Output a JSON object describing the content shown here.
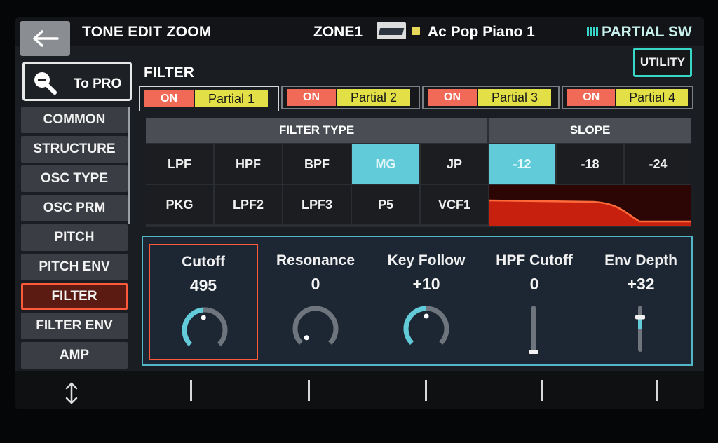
{
  "header": {
    "title": "TONE EDIT ZOOM",
    "zone": "ZONE1",
    "tone_name": "Ac Pop Piano 1",
    "partial_sw": "PARTIAL SW"
  },
  "sidebar": {
    "to_pro": "To PRO",
    "items": [
      {
        "label": "COMMON"
      },
      {
        "label": "STRUCTURE"
      },
      {
        "label": "OSC TYPE"
      },
      {
        "label": "OSC PRM"
      },
      {
        "label": "PITCH"
      },
      {
        "label": "PITCH ENV"
      },
      {
        "label": "FILTER"
      },
      {
        "label": "FILTER ENV"
      },
      {
        "label": "AMP"
      }
    ],
    "active": "FILTER"
  },
  "section_title": "FILTER",
  "utility": "UTILITY",
  "partials": [
    {
      "on": "ON",
      "name": "Partial 1"
    },
    {
      "on": "ON",
      "name": "Partial 2"
    },
    {
      "on": "ON",
      "name": "Partial 3"
    },
    {
      "on": "ON",
      "name": "Partial 4"
    }
  ],
  "filter_type": {
    "header": "FILTER TYPE",
    "row1": [
      "LPF",
      "HPF",
      "BPF",
      "MG",
      "JP"
    ],
    "row2": [
      "PKG",
      "LPF2",
      "LPF3",
      "P5",
      "VCF1"
    ],
    "selected": "MG"
  },
  "slope": {
    "header": "SLOPE",
    "options": [
      "-12",
      "-18",
      "-24"
    ],
    "selected": "-12"
  },
  "knobs": [
    {
      "label": "Cutoff",
      "value": "495",
      "level": 0.48
    },
    {
      "label": "Resonance",
      "value": "0",
      "level": 0.0
    },
    {
      "label": "Key Follow",
      "value": "+10",
      "level": 0.5
    },
    {
      "label": "HPF Cutoff",
      "value": "0",
      "level": 0.0
    },
    {
      "label": "Env Depth",
      "value": "+32",
      "level": 0.75
    }
  ],
  "colors": {
    "accent": "#61cbd9",
    "focus": "#ff5a3a",
    "on_badge": "#f06a57",
    "partial_badge": "#e2e046",
    "curve": "#ff3a1e"
  }
}
